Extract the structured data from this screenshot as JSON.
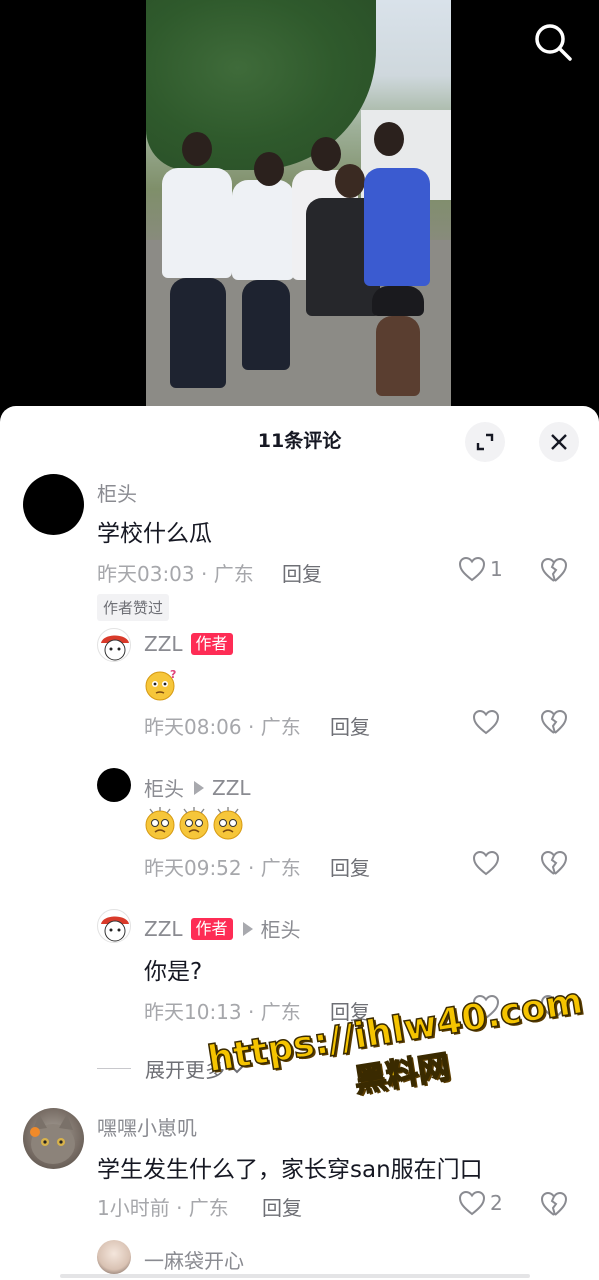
{
  "header": {
    "search_icon": "search-icon"
  },
  "sheet": {
    "title": "11条评论",
    "expand_icon": "expand-icon",
    "close_icon": "close-icon"
  },
  "comments": [
    {
      "user": "柜头",
      "text": "学校什么瓜",
      "meta": "昨天03:03 · 广东",
      "reply_label": "回复",
      "likes": "1",
      "badge": "作者赞过"
    },
    {
      "user": "ZZL",
      "author_tag": "作者",
      "meta": "昨天08:06 · 广东",
      "reply_label": "回复",
      "emoji": [
        "confused-face-emoji"
      ]
    },
    {
      "user": "柜头",
      "reply_to": "ZZL",
      "meta": "昨天09:52 · 广东",
      "reply_label": "回复",
      "emoji": [
        "dizzy-face-emoji",
        "dizzy-face-emoji",
        "dizzy-face-emoji"
      ]
    },
    {
      "user": "ZZL",
      "author_tag": "作者",
      "reply_to": "柜头",
      "text": "你是?",
      "meta": "昨天10:13 · 广东",
      "reply_label": "回复"
    },
    {
      "user": "嘿嘿小崽叽",
      "text": "学生发生什么了，家长穿san服在门口",
      "meta": "1小时前 · 广东",
      "reply_label": "回复",
      "likes": "2"
    },
    {
      "user": "一麻袋开心"
    }
  ],
  "expand_more": "展开更多",
  "watermark": {
    "url": "https://ihlw40.com",
    "name": "黑料网"
  },
  "colors": {
    "author_tag": "#fe2c55",
    "watermark": "#f5c400"
  }
}
